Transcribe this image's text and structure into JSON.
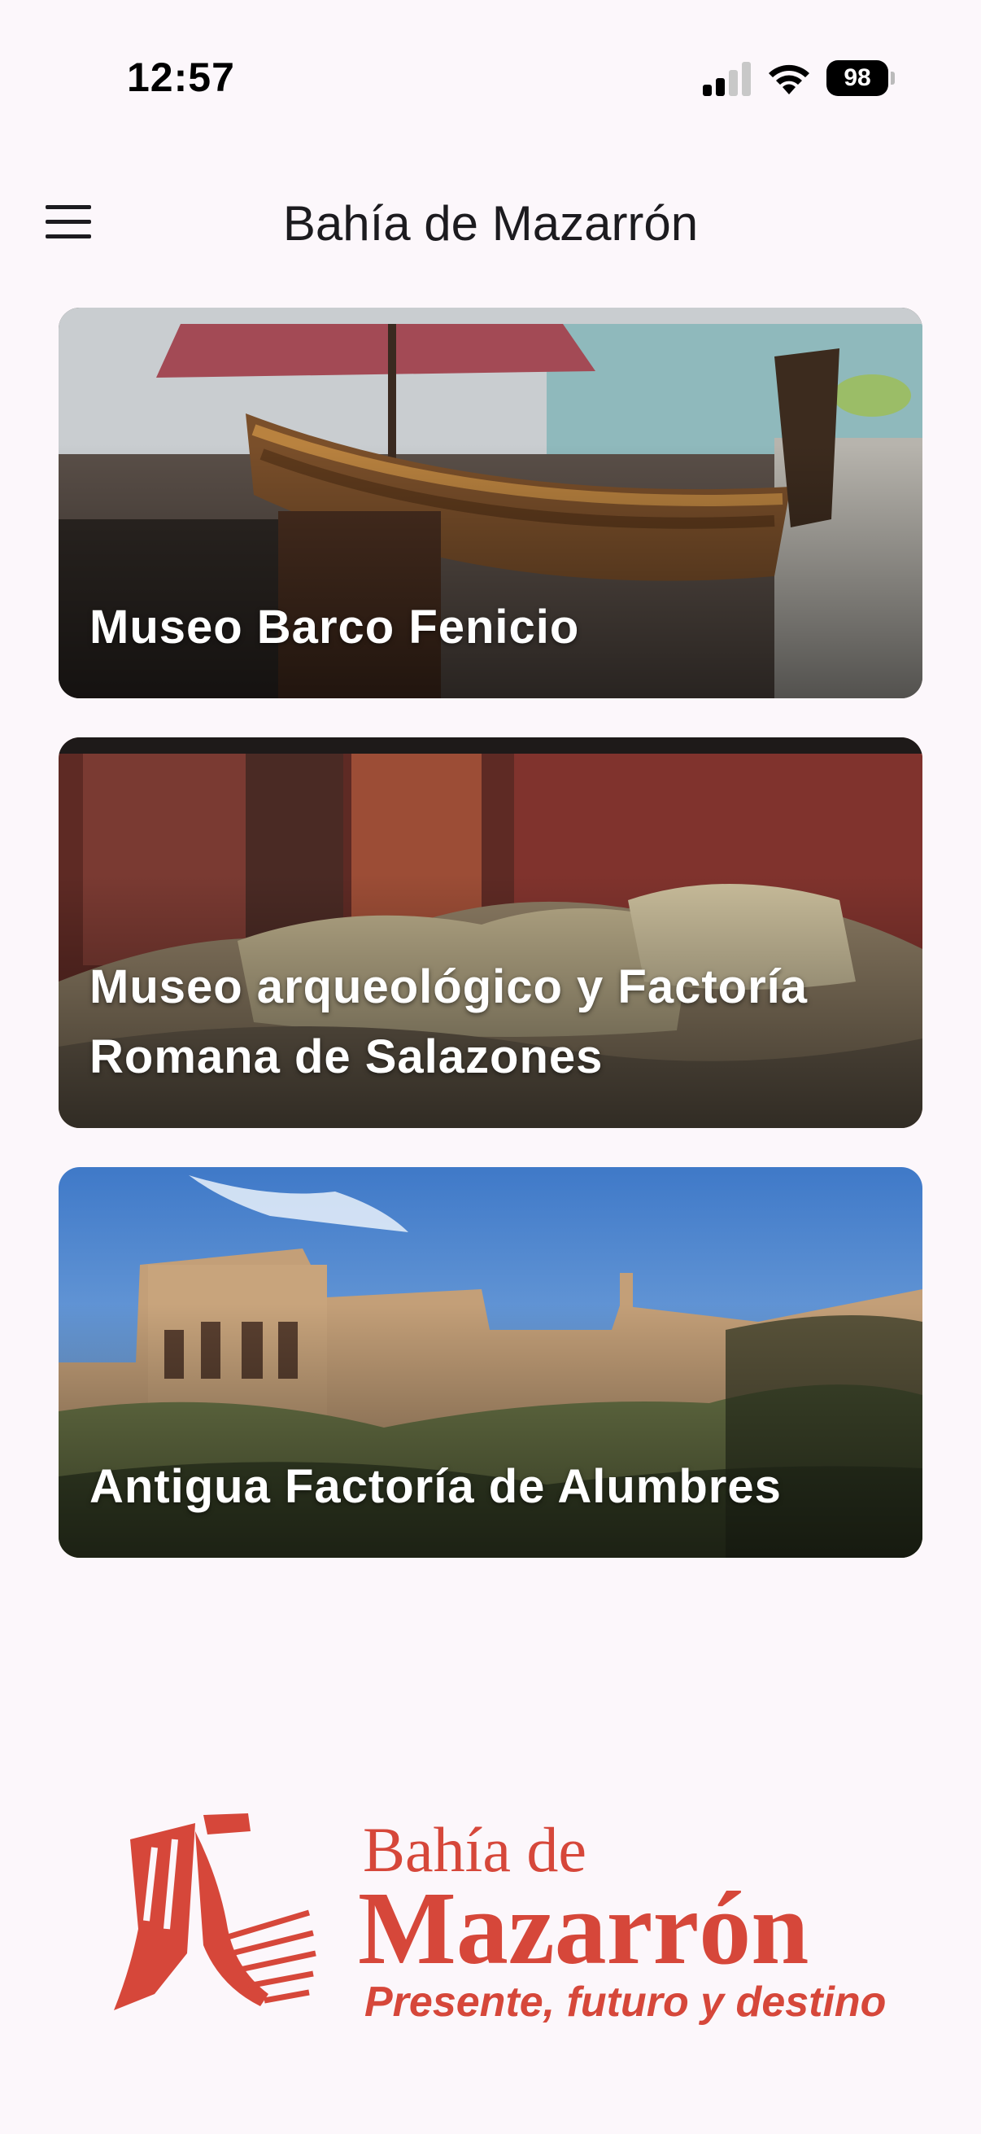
{
  "status_bar": {
    "time": "12:57",
    "battery": "98",
    "icons": [
      "cellular-signal-icon",
      "wifi-icon",
      "battery-icon"
    ]
  },
  "app_bar": {
    "title": "Bahía de Mazarrón",
    "menu_icon": "menu-icon"
  },
  "cards": [
    {
      "title": "Museo Barco Fenicio"
    },
    {
      "title": "Museo arqueológico y Factoría Romana de Salazones"
    },
    {
      "title": "Antigua Factoría de Alumbres"
    }
  ],
  "logo": {
    "line1": "Bahía de",
    "line2": "Mazarrón",
    "line3": "Presente, futuro y destino",
    "color": "#d6473a"
  },
  "colors": {
    "background": "#fcf7fb",
    "brand": "#d6473a"
  }
}
